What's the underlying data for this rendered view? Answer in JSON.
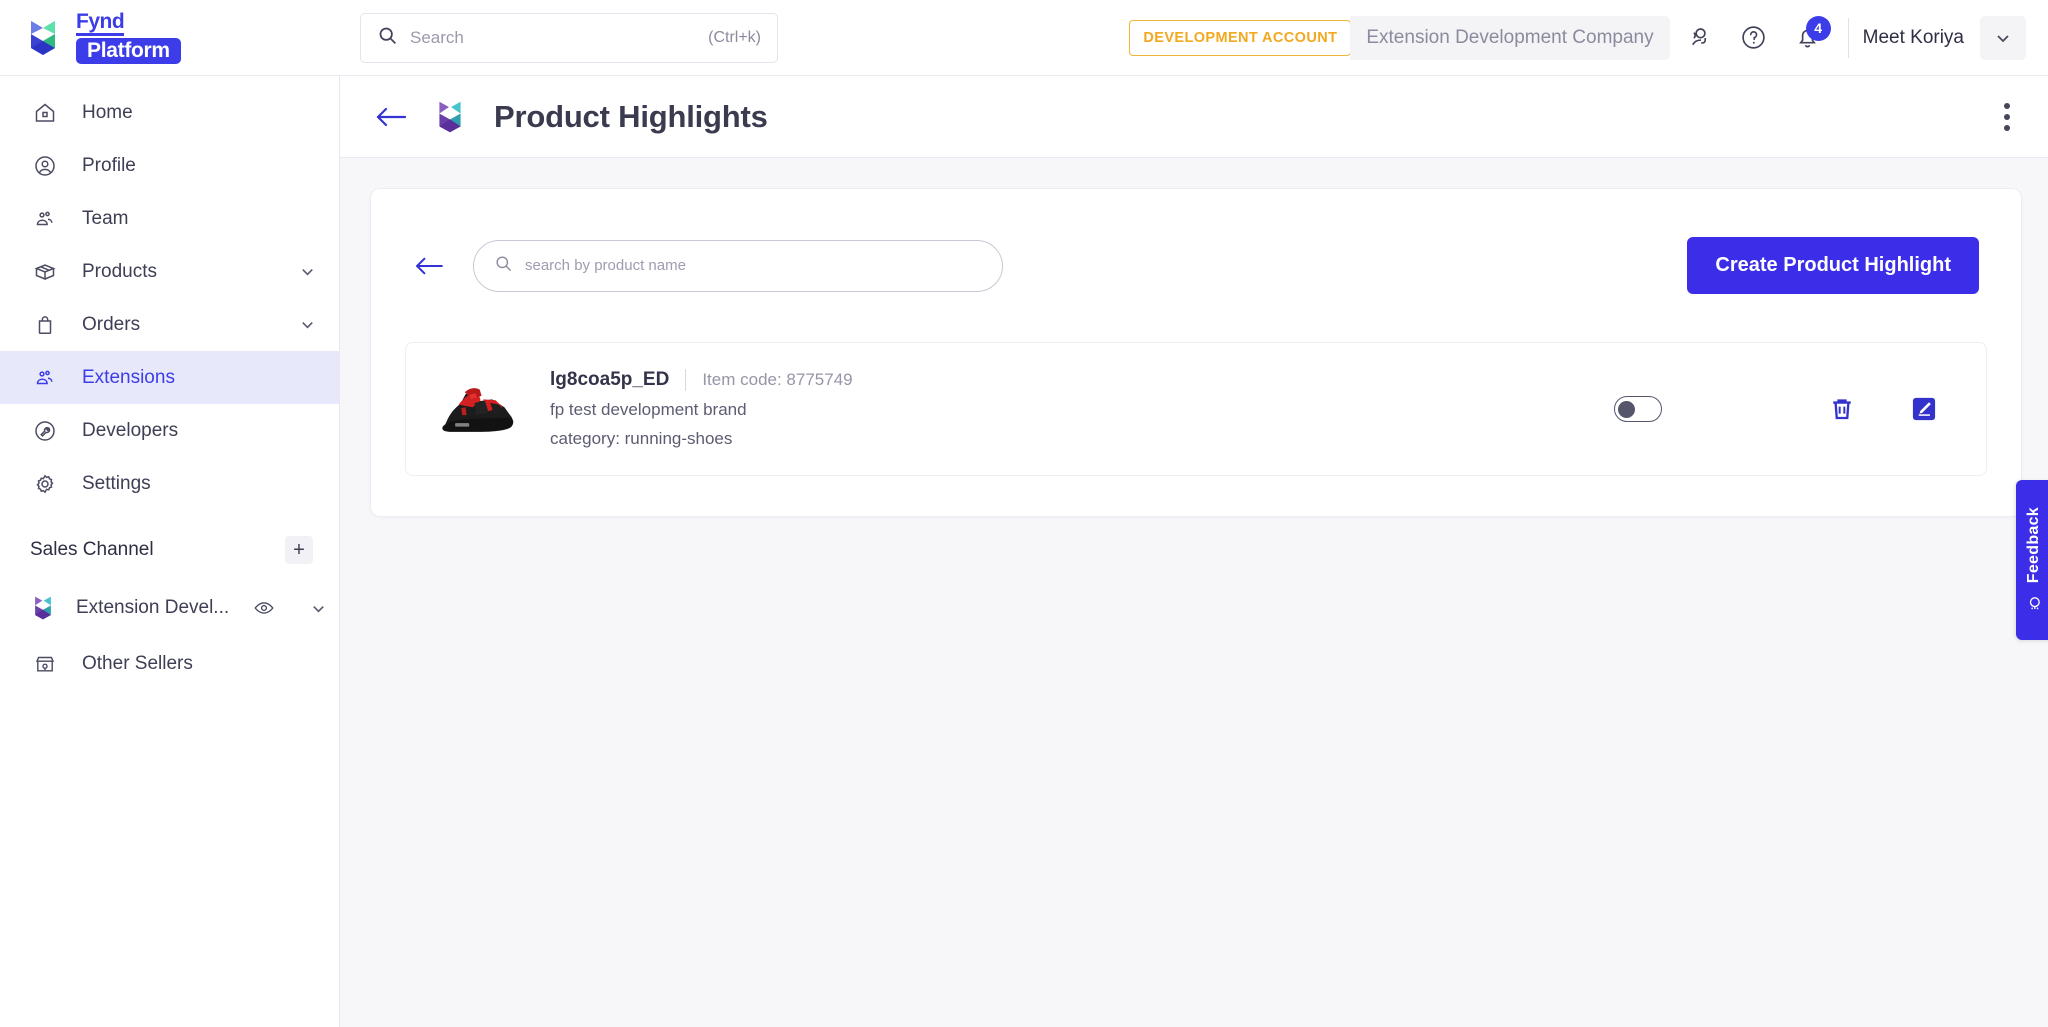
{
  "brand": {
    "fynd": "Fynd",
    "platform": "Platform",
    "logo_icon": "fynd-heart-logo"
  },
  "topbar": {
    "search": {
      "value": "",
      "placeholder": "Search",
      "shortcut": "(Ctrl+k)",
      "icon": "search-icon"
    },
    "dev_badge": "DEVELOPMENT ACCOUNT",
    "company": "Extension Development Company",
    "support_icon": "support-headset-icon",
    "help_icon": "question-circle-icon",
    "bell_icon": "bell-icon",
    "notification_count": "4",
    "user_name": "Meet Koriya",
    "user_caret_icon": "chevron-down-icon",
    "accent_color": "#3c3ce8",
    "warning_color": "#f2a81f"
  },
  "sidebar": {
    "items": [
      {
        "label": "Home",
        "icon": "home-icon",
        "active": false,
        "caret": false
      },
      {
        "label": "Profile",
        "icon": "user-circle-icon",
        "active": false,
        "caret": false
      },
      {
        "label": "Team",
        "icon": "people-icon",
        "active": false,
        "caret": false
      },
      {
        "label": "Products",
        "icon": "box-icon",
        "active": false,
        "caret": true
      },
      {
        "label": "Orders",
        "icon": "bag-icon",
        "active": false,
        "caret": true
      },
      {
        "label": "Extensions",
        "icon": "people-icon",
        "active": true,
        "caret": false
      },
      {
        "label": "Developers",
        "icon": "wrench-circle-icon",
        "active": false,
        "caret": false
      },
      {
        "label": "Settings",
        "icon": "gear-icon",
        "active": false,
        "caret": false
      }
    ],
    "section_title": "Sales Channel",
    "add_icon": "plus-icon",
    "channels": [
      {
        "label": "Extension Devel...",
        "icon": "extension-heart-logo",
        "eye_icon": "eye-icon",
        "caret_icon": "chevron-down-icon"
      },
      {
        "label": "Other Sellers",
        "icon": "store-icon"
      }
    ]
  },
  "page": {
    "back_icon": "arrow-left-icon",
    "logo_icon": "extension-heart-logo",
    "title": "Product Highlights",
    "kebab_icon": "kebab-menu-icon"
  },
  "toolbar": {
    "back_icon": "arrow-left-icon",
    "search": {
      "value": "",
      "placeholder": "search by product name",
      "icon": "search-icon"
    },
    "create_label": "Create Product Highlight"
  },
  "products": [
    {
      "thumbnail": "red-black-sandal-image",
      "name": "lg8coa5p_ED",
      "item_code": "Item code: 8775749",
      "brand": "fp test development brand",
      "category": "category: running-shoes",
      "toggle_on": false,
      "delete_icon": "trash-icon",
      "edit_icon": "edit-pencil-icon"
    }
  ],
  "feedback": {
    "label": "Feedback",
    "icon": "lightbulb-icon"
  }
}
